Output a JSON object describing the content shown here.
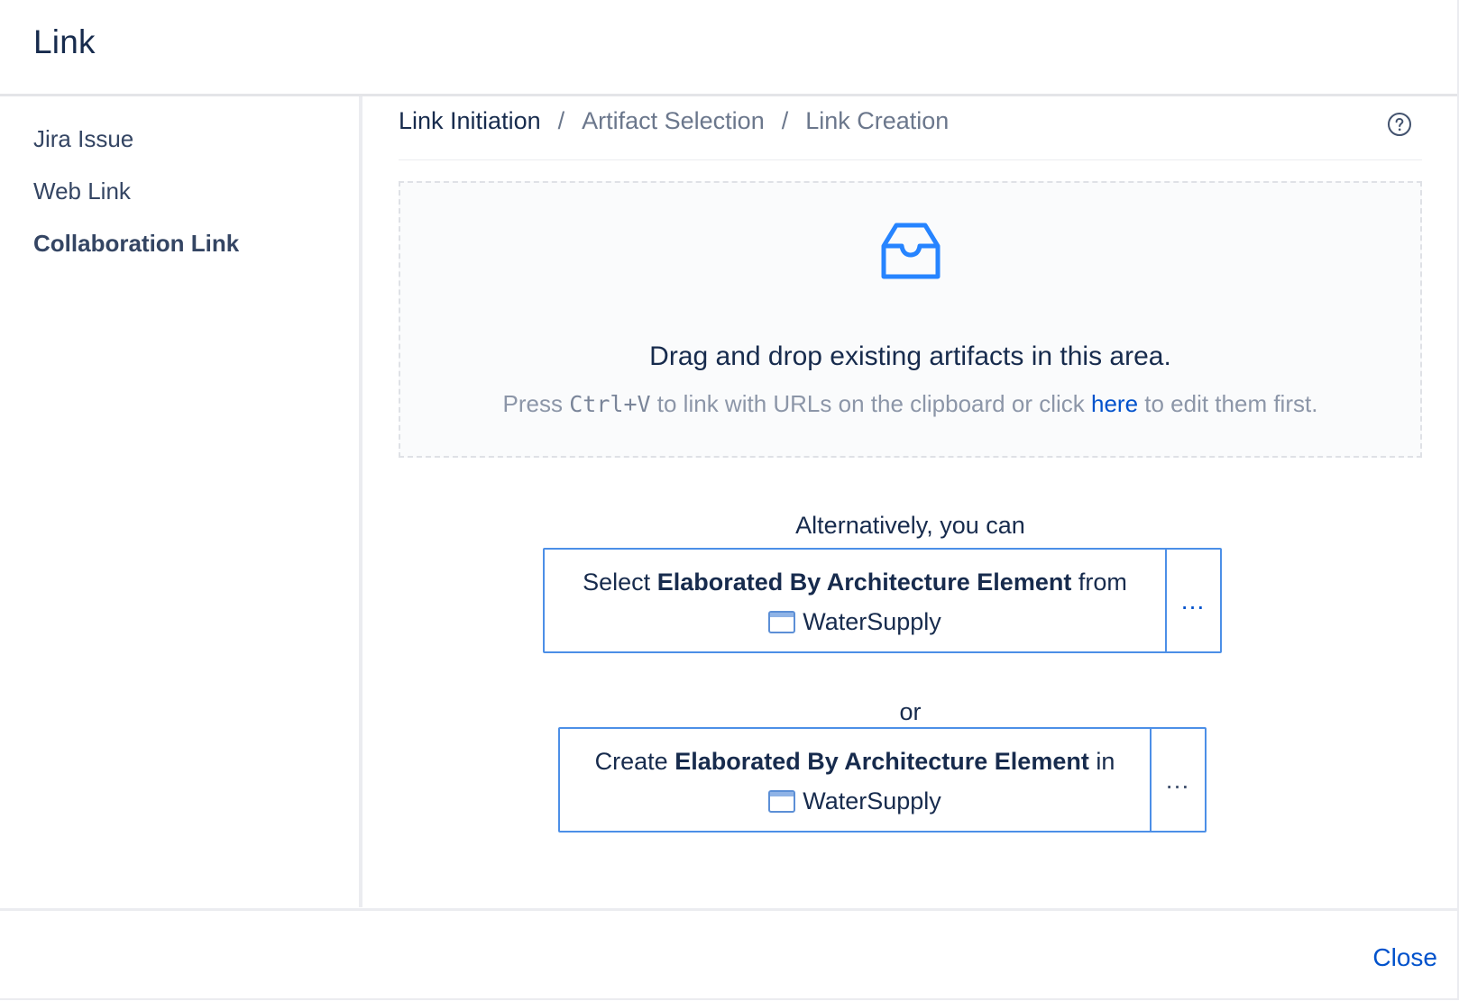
{
  "dialog": {
    "title": "Link"
  },
  "sidebar": {
    "items": [
      {
        "label": "Jira Issue",
        "active": false
      },
      {
        "label": "Web Link",
        "active": false
      },
      {
        "label": "Collaboration Link",
        "active": true
      }
    ]
  },
  "breadcrumb": {
    "items": [
      "Link Initiation",
      "Artifact Selection",
      "Link Creation"
    ],
    "separator": "/",
    "current_index": 0
  },
  "help": {
    "icon": "help-circle-icon"
  },
  "dropzone": {
    "icon": "inbox-icon",
    "title": "Drag and drop existing artifacts in this area.",
    "sub_before": "Press ",
    "shortcut": "Ctrl+V",
    "sub_middle": " to link with URLs on the clipboard or click ",
    "link_text": "here",
    "sub_after": " to edit them first."
  },
  "alternatives": {
    "intro": "Alternatively, you can",
    "or": "or",
    "select": {
      "verb": "Select ",
      "type": "Elaborated By Architecture Element",
      "preposition": " from",
      "project_icon": "window-icon",
      "project": "WaterSupply",
      "more": "…"
    },
    "create": {
      "verb": "Create ",
      "type": "Elaborated By Architecture Element",
      "preposition": " in",
      "project_icon": "window-icon",
      "project": "WaterSupply",
      "more": "…"
    }
  },
  "footer": {
    "close_label": "Close"
  },
  "colors": {
    "accent": "#0052cc",
    "icon_blue": "#2684ff",
    "box_border": "#4c8fe7",
    "text": "#172b4d",
    "muted": "#6b778c"
  }
}
